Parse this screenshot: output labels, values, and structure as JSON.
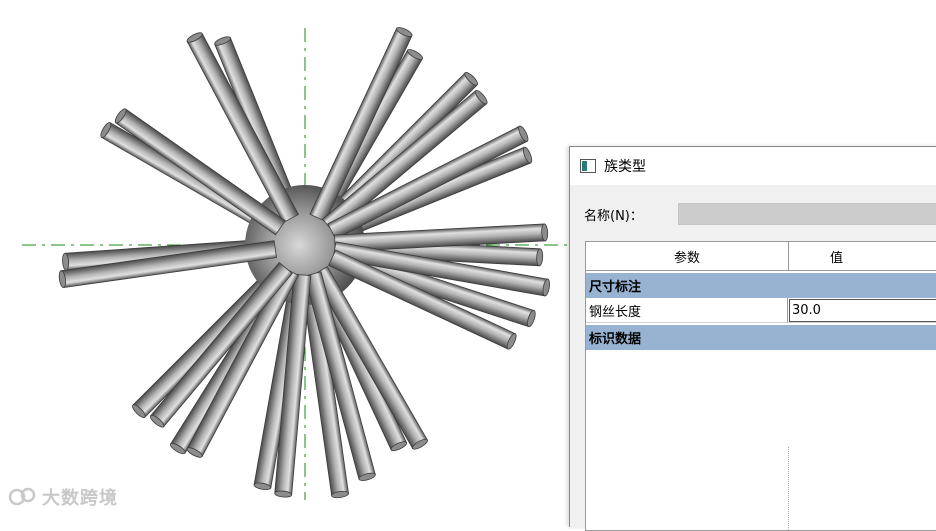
{
  "dialog": {
    "title": "族类型",
    "name_label": "名称(N)：",
    "name_value": "",
    "columns": {
      "param": "参数",
      "value": "值"
    },
    "groups": [
      {
        "label": "尺寸标注",
        "params": [
          {
            "name": "钢丝长度",
            "value": "30.0"
          }
        ]
      },
      {
        "label": "标识数据",
        "params": []
      }
    ]
  },
  "watermark": {
    "text": "大数跨境"
  },
  "colors": {
    "group_header": "#98b3d2",
    "crosshair": "#1a8a1a",
    "rod": "#a8a8a8",
    "sphere": "#6e6e6e"
  }
}
